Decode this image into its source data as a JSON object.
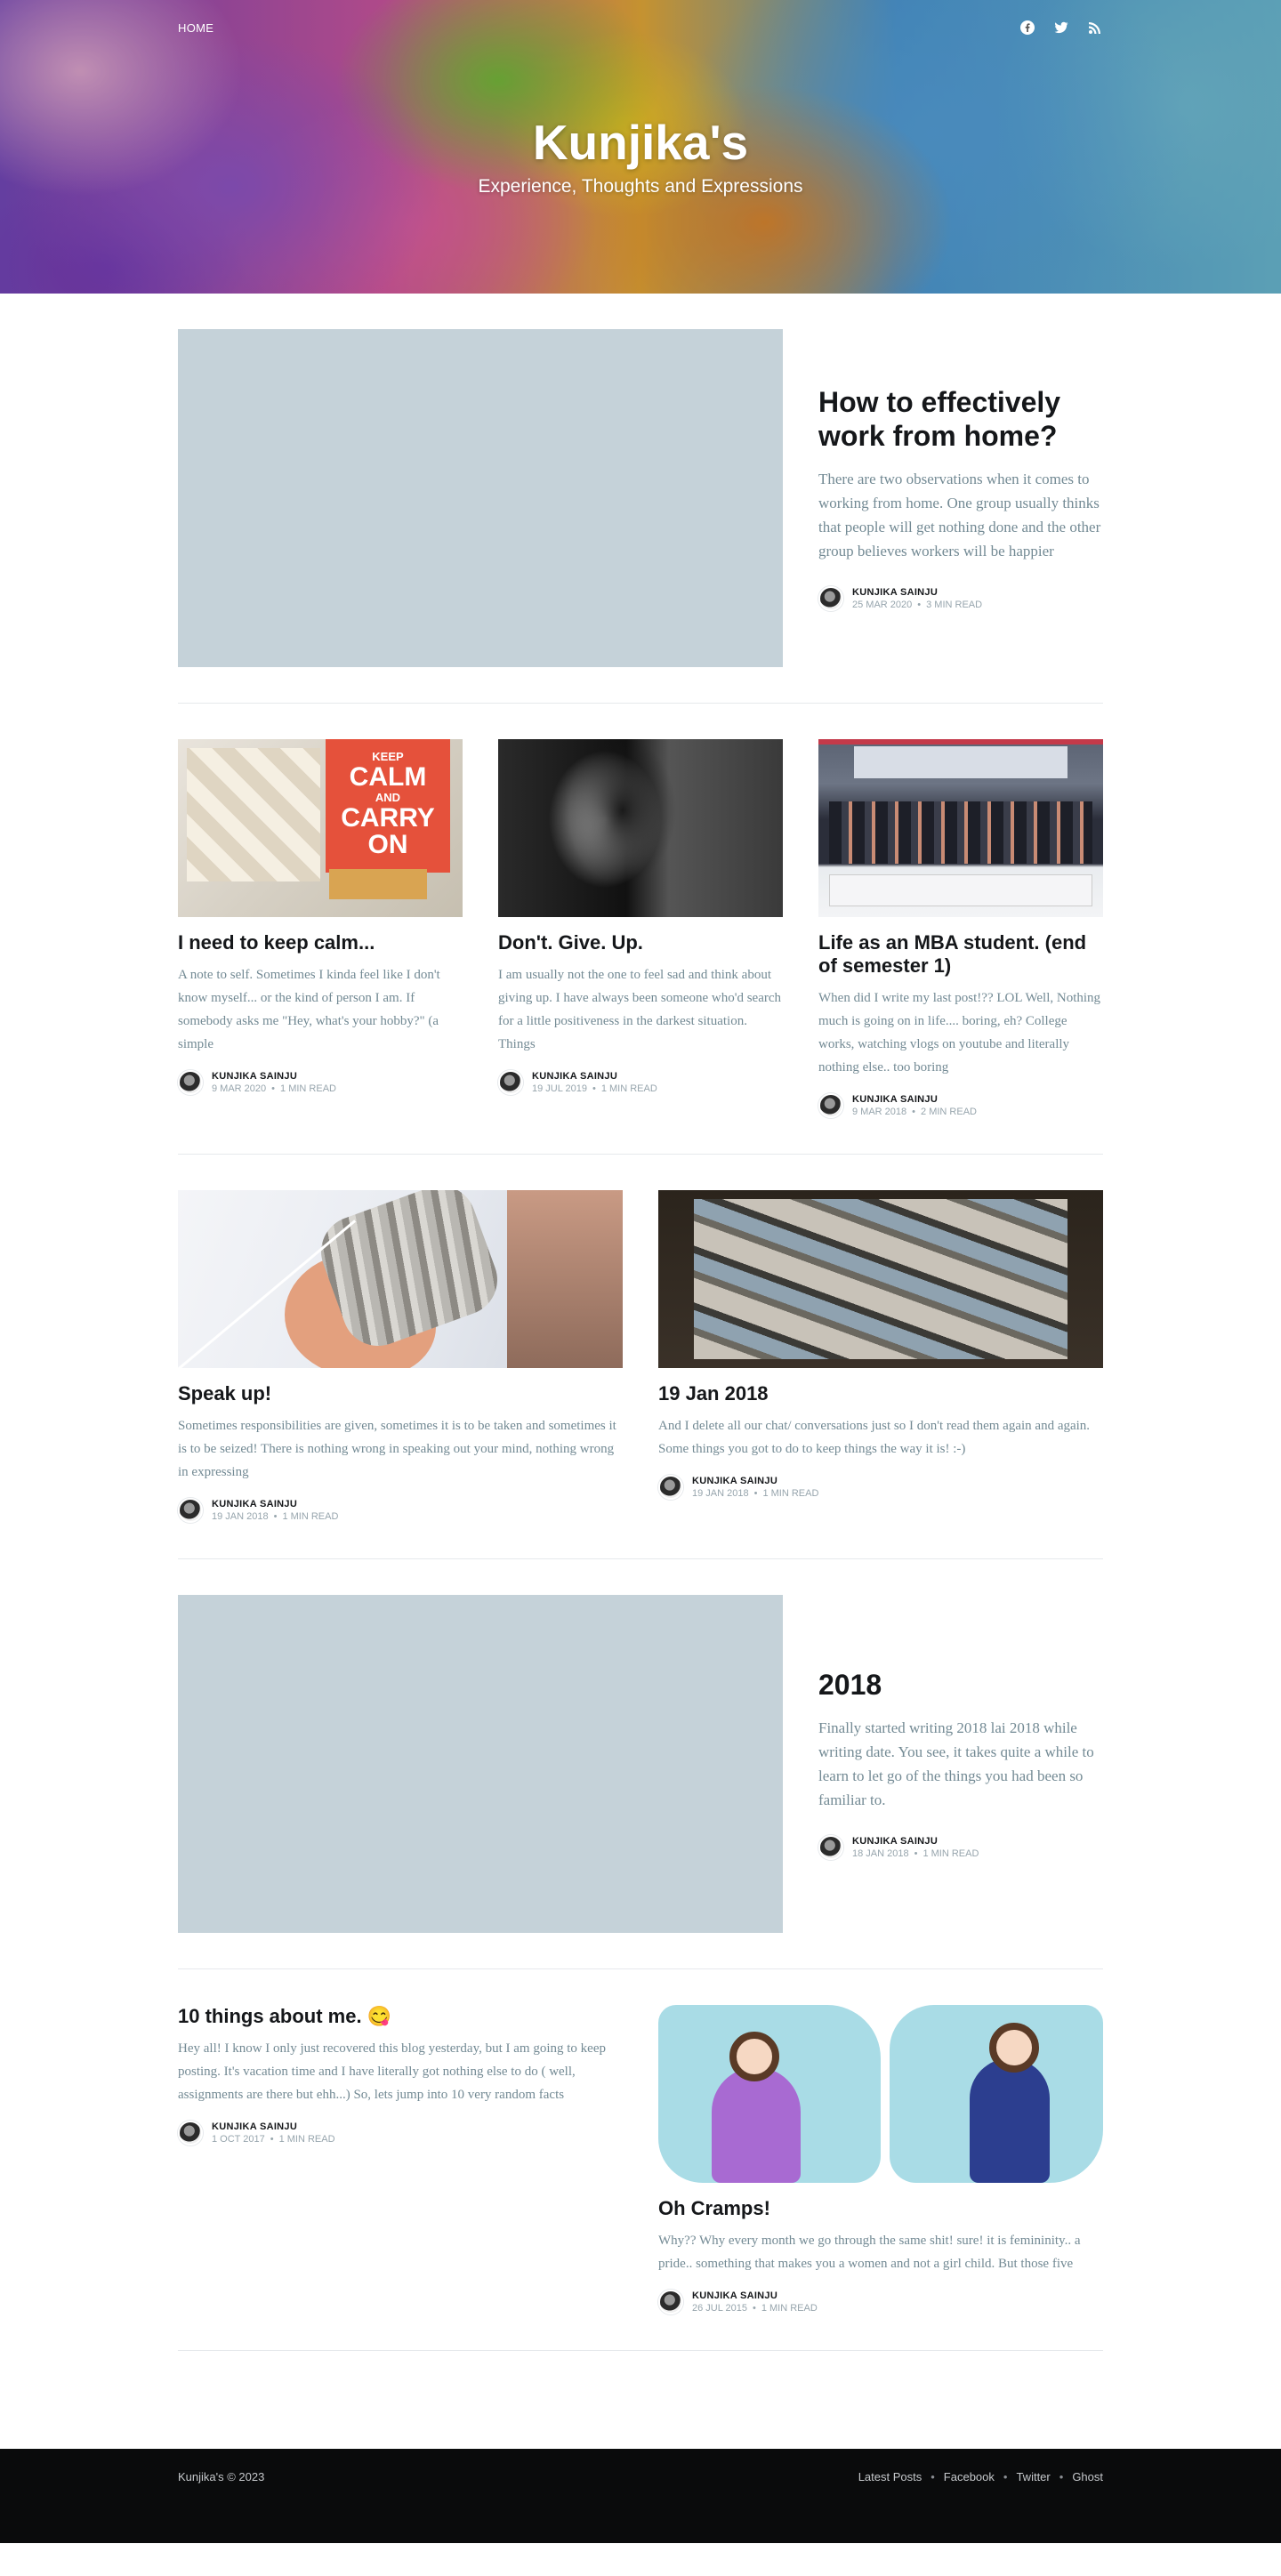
{
  "header": {
    "nav_home": "HOME",
    "site_title": "Kunjika's",
    "site_description": "Experience, Thoughts and Expressions",
    "social_icons": [
      "facebook-icon",
      "twitter-icon",
      "rss-icon"
    ]
  },
  "posts": [
    {
      "title": "How to effectively work from home?",
      "excerpt": "There are two observations when it comes to working from home. One group usually thinks that people will get nothing done  and the other group believes workers will be happier",
      "author": "KUNJIKA SAINJU",
      "date": "25 MAR 2020",
      "read": "3 MIN READ"
    },
    {
      "title": "I need to keep calm...",
      "excerpt": "A note to self. Sometimes I kinda feel like I don't know myself... or the kind of person I am. If somebody asks me \"Hey, what's your hobby?\" (a simple",
      "author": "KUNJIKA SAINJU",
      "date": "9 MAR 2020",
      "read": "1 MIN READ",
      "poster_text": [
        "KEEP",
        "CALM",
        "AND",
        "CARRY",
        "ON"
      ]
    },
    {
      "title": "Don't. Give. Up.",
      "excerpt": "I am usually not the one to feel sad and think about giving up. I have always been someone who'd search for a little positiveness in the darkest situation. Things",
      "author": "KUNJIKA SAINJU",
      "date": "19 JUL 2019",
      "read": "1 MIN READ"
    },
    {
      "title": "Life as an MBA student. (end of semester 1)",
      "excerpt": "When did I write my last post!??  LOL Well, Nothing much is going on in life.... boring, eh? College works, watching vlogs on youtube and literally nothing else.. too boring",
      "author": "KUNJIKA SAINJU",
      "date": "9 MAR 2018",
      "read": "2 MIN READ"
    },
    {
      "title": "Speak up!",
      "excerpt": "Sometimes responsibilities are given, sometimes it is to be taken and sometimes it is to be seized! There is nothing wrong in speaking out your mind, nothing wrong in expressing",
      "author": "KUNJIKA SAINJU",
      "date": "19 JAN 2018",
      "read": "1 MIN READ"
    },
    {
      "title": "19 Jan 2018",
      "excerpt": "And I delete all our chat/ conversations just so I don't read them again and again. Some things you got to do to keep things the way it is! :-)",
      "author": "KUNJIKA SAINJU",
      "date": "19 JAN 2018",
      "read": "1 MIN READ"
    },
    {
      "title": "2018",
      "excerpt": "Finally started writing 2018 lai 2018 while writing date. You see, it takes quite a while to learn to let go of the things you had been so familiar to.",
      "author": "KUNJIKA SAINJU",
      "date": "18 JAN 2018",
      "read": "1 MIN READ"
    },
    {
      "title": "10 things about me. 😋",
      "excerpt": "Hey all! I know I only just recovered this blog yesterday, but I am going to keep posting. It's vacation time and I have literally got nothing else to do ( well, assignments are there but ehh...) So, lets jump into 10 very random facts",
      "author": "KUNJIKA SAINJU",
      "date": "1 OCT 2017",
      "read": "1 MIN READ"
    },
    {
      "title": "Oh Cramps!",
      "excerpt": "Why?? Why every month we go through the same shit! sure! it is femininity.. a pride.. something that makes you a women and not a girl child. But those five",
      "author": "KUNJIKA SAINJU",
      "date": "26 JUL 2015",
      "read": "1 MIN READ"
    }
  ],
  "footer": {
    "copyright": "Kunjika's © 2023",
    "links": [
      "Latest Posts",
      "Facebook",
      "Twitter",
      "Ghost"
    ],
    "separator": "•"
  }
}
